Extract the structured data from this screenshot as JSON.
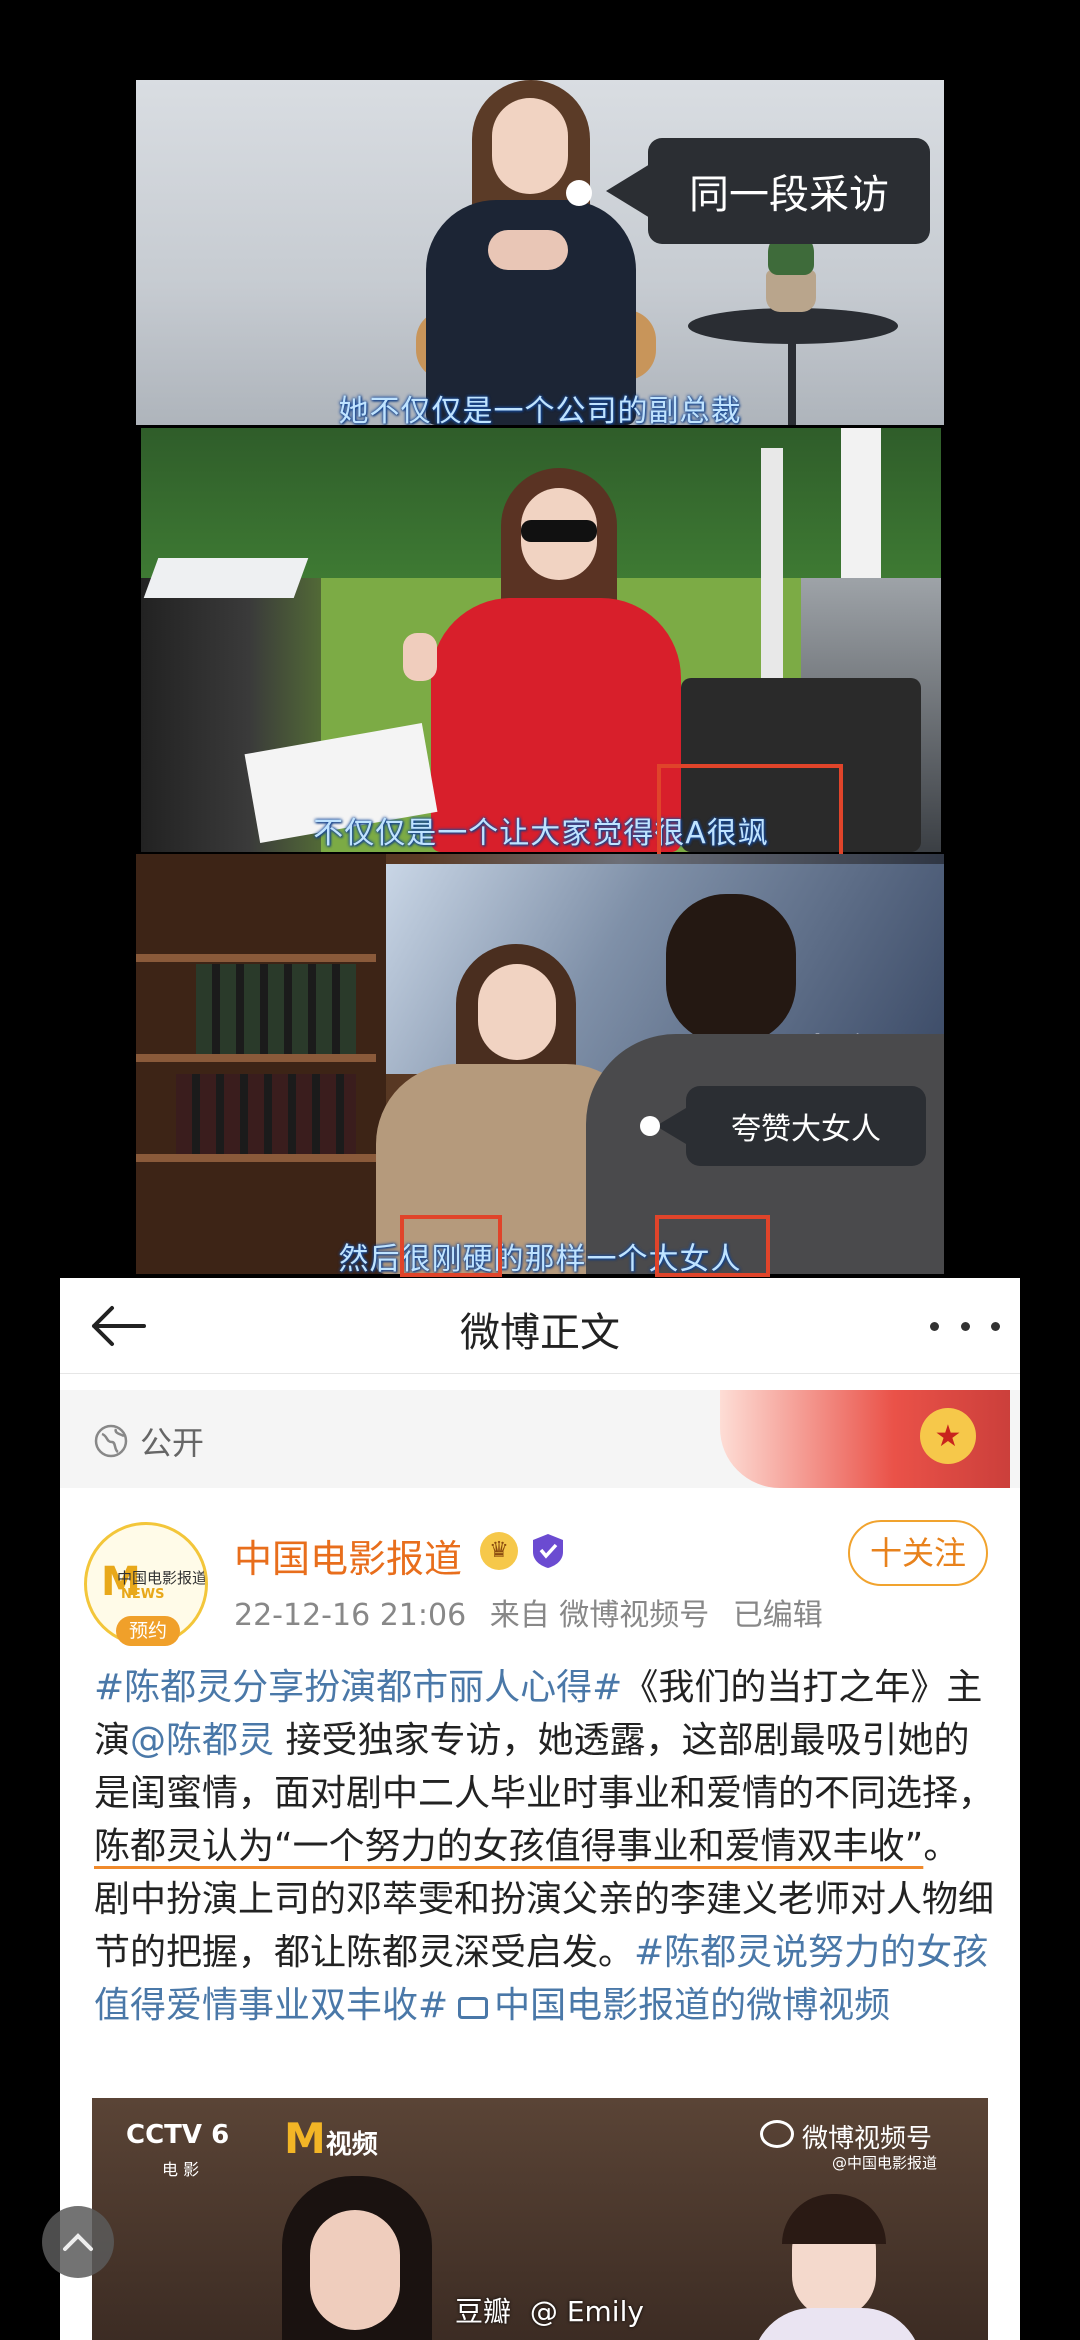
{
  "frames": [
    {
      "subtitle": "她不仅仅是一个公司的副总裁",
      "tag": "同一段采访"
    },
    {
      "subtitle": "不仅仅是一个让大家觉得很A很飒"
    },
    {
      "subtitle": "然后很刚硬的那样一个大女人",
      "tag": "夸赞大女人",
      "screen_text": "一批在"
    }
  ],
  "nav": {
    "title": "微博正文"
  },
  "visibility": {
    "label": "公开"
  },
  "post": {
    "author": "中国电影报道",
    "avatar_text": "中国电影报道",
    "avatar_sub": "NEWS",
    "avatar_badge": "预约",
    "follow_label": "十关注",
    "meta_time": "22-12-16 21:06",
    "meta_source": "来自 微博视频号",
    "meta_edited": "已编辑",
    "text": {
      "hashtag1": "#陈都灵分享扮演都市丽人心得#",
      "p1": "《我们的当打之年》主演",
      "mention": "@陈都灵",
      "p2": " 接受独家专访，她透露，这部剧最吸引她的是闺蜜情，面对剧中二人毕业时事业和爱情的不同选择，",
      "quote": "陈都灵认为“一个努力的女孩值得事业和爱情双丰收”",
      "p3": "。剧中扮演上司的邓萃雯和扮演父亲的李建义老师对人物细节的把握，都让陈都灵深受启发。",
      "hashtag2": "#陈都灵说努力的女孩值得爱情事业双丰收#",
      "video_link": "中国电影报道的微博视频"
    }
  },
  "video": {
    "channel": "CCTV 6",
    "channel_sub": "电 影",
    "brand": "视频",
    "brand_letter": "M",
    "weibo_label": "微博视频号",
    "weibo_sub": "@中国电影报道"
  },
  "watermark": {
    "site": "豆瓣",
    "user": "@ Emily"
  }
}
